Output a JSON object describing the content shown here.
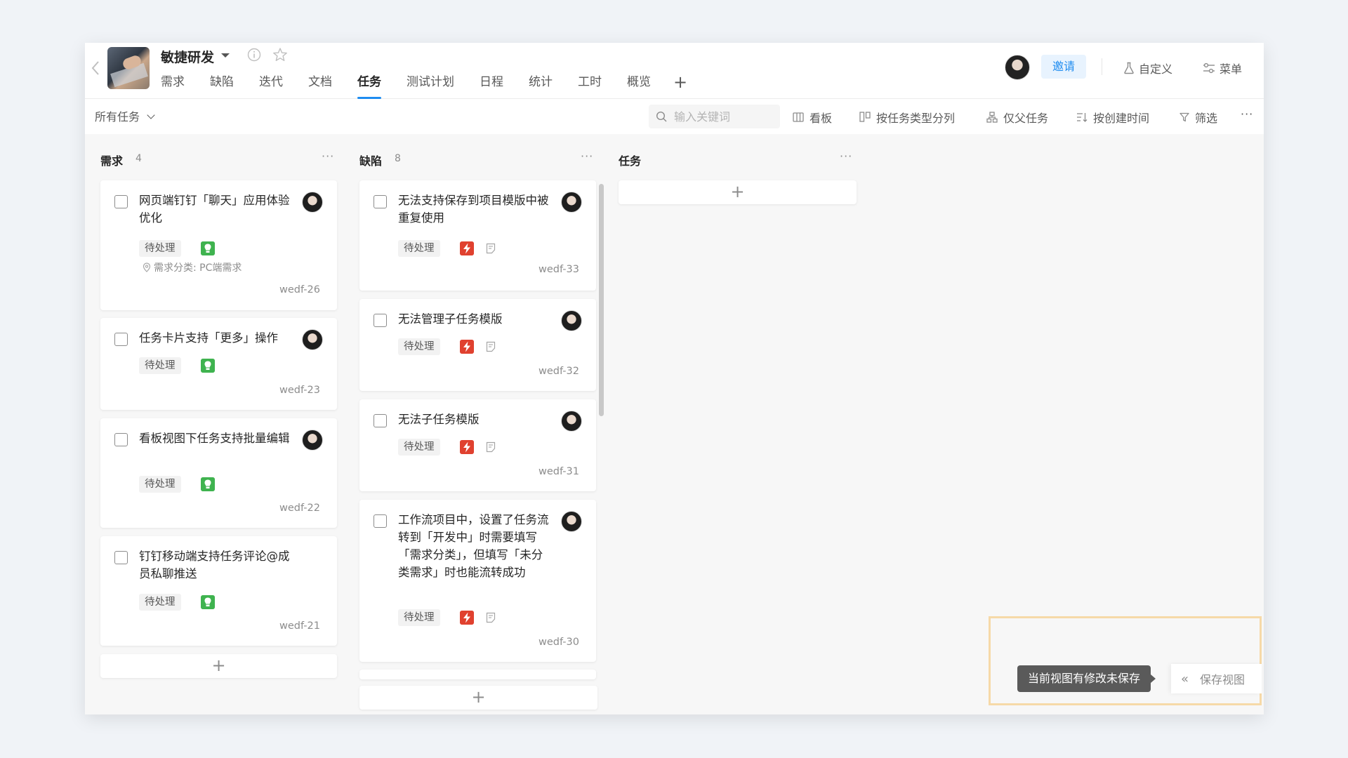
{
  "header": {
    "project_name": "敏捷研发",
    "tabs": [
      {
        "label": "需求"
      },
      {
        "label": "缺陷"
      },
      {
        "label": "迭代"
      },
      {
        "label": "文档"
      },
      {
        "label": "任务"
      },
      {
        "label": "测试计划"
      },
      {
        "label": "日程"
      },
      {
        "label": "统计"
      },
      {
        "label": "工时"
      },
      {
        "label": "概览"
      }
    ],
    "active_tab": "任务",
    "tab_add": "+",
    "invite_label": "邀请",
    "customize_label": "自定义",
    "menu_label": "菜单"
  },
  "toolbar": {
    "scope_label": "所有任务",
    "search_placeholder": "输入关键词",
    "board_label": "看板",
    "group_label": "按任务类型分列",
    "parent_only_label": "仅父任务",
    "sort_label": "按创建时间",
    "filter_label": "筛选",
    "more_label": "···"
  },
  "columns": [
    {
      "title": "需求",
      "count": "4",
      "more": "···",
      "cards": [
        {
          "title": "网页端钉钉「聊天」应用体验优化",
          "status": "待处理",
          "meta": "需求分类: PC端需求",
          "id": "wedf-26"
        },
        {
          "title": "任务卡片支持「更多」操作",
          "status": "待处理",
          "id": "wedf-23"
        },
        {
          "title": "看板视图下任务支持批量编辑",
          "status": "待处理",
          "id": "wedf-22"
        },
        {
          "title": "钉钉移动端支持任务评论@成员私聊推送",
          "status": "待处理",
          "id": "wedf-21"
        }
      ],
      "add_label": "+"
    },
    {
      "title": "缺陷",
      "count": "8",
      "more": "···",
      "cards": [
        {
          "title": "无法支持保存到项目模版中被重复使用",
          "status": "待处理",
          "id": "wedf-33"
        },
        {
          "title": "无法管理子任务模版",
          "status": "待处理",
          "id": "wedf-32"
        },
        {
          "title": "无法子任务模版",
          "status": "待处理",
          "id": "wedf-31"
        },
        {
          "title": "工作流项目中，设置了任务流转到「开发中」时需要填写「需求分类」，但填写「未分类需求」时也能流转成功",
          "status": "待处理",
          "id": "wedf-30"
        }
      ],
      "add_label": "+"
    },
    {
      "title": "任务",
      "count": "",
      "more": "···",
      "cards": [],
      "add_label": "+"
    }
  ],
  "save_view": {
    "tip": "当前视图有修改未保存",
    "button_label": "保存视图",
    "chevron": "«"
  },
  "colors": {
    "accent": "#1e8cf0",
    "requirement_icon": "#3fb34f",
    "bug_icon": "#e0412f",
    "highlight_frame": "#f6d9a8"
  },
  "icons": [
    "back-arrow-icon",
    "info-icon",
    "star-icon",
    "flask-icon",
    "menu-sliders-icon",
    "search-icon",
    "board-icon",
    "columns-icon",
    "parent-task-icon",
    "sort-icon",
    "filter-icon",
    "requirement-bulb-icon",
    "bug-bolt-icon",
    "note-icon",
    "location-pin-icon"
  ]
}
